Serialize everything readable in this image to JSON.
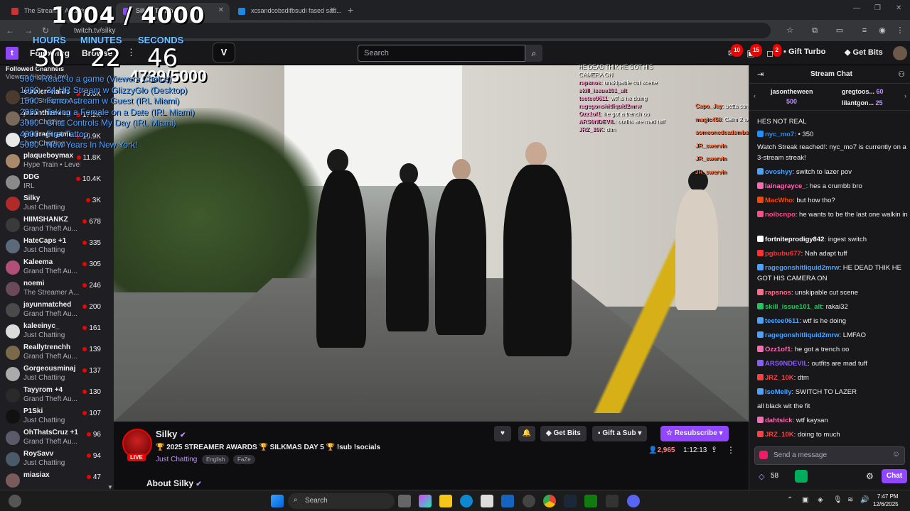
{
  "browser": {
    "tabs": [
      {
        "label": "The Streamer Awards",
        "active": false
      },
      {
        "label": "Silky - Twitch",
        "active": true
      },
      {
        "label": "xcsandcobsdifbsudi fased sad...",
        "active": false
      }
    ],
    "url": "twitch.tv/silky"
  },
  "topnav": {
    "following": "Following",
    "browse": "Browse",
    "search_placeholder": "Search",
    "notif_counts": [
      "10",
      "15",
      "2"
    ],
    "gift_turbo": "Gift Turbo",
    "get_bits": "Get Bits"
  },
  "overlay": {
    "goal": "1004 / 4000",
    "hours_label": "HOURS",
    "minutes_label": "MINUTES",
    "seconds_label": "SECONDS",
    "hours": "30",
    "minutes": "22",
    "seconds": "46",
    "sub_goal": "4739/5000",
    "list": [
      "500 - React to a game (Viewers Choice)",
      "1000 - 24 HR Stream w GlizzyGlo (Desktop)",
      "1500 - Ferrox stream w Guest (IRL Miami)",
      "2000 - Taking a Female on a Date (IRL Miami)",
      "3000 - Chat Controls My Day (IRL Miami)",
      "4000 - First Tattoo",
      "5000 - New Years In New York!"
    ],
    "chat_mid": [
      {
        "user": "",
        "text": "HE DEAD THIK HE GOT HIS"
      },
      {
        "user": "",
        "text": "CAMERA ON"
      },
      {
        "user": "rapsnos",
        "text": "unskipable cut scene"
      },
      {
        "user": "skill_issue101_alt",
        "text": ""
      },
      {
        "user": "teetee0611",
        "text": "wtf is he doing"
      },
      {
        "user": "ragegonshitliquid2mrw",
        "text": ""
      },
      {
        "user": "Ozz1of1",
        "text": "he got a trench oo"
      },
      {
        "user": "ARS0NDEVIL",
        "text": "outfits are mad tuff"
      },
      {
        "user": "JRZ_10K",
        "text": "dtm"
      }
    ],
    "chat_right": [
      {
        "user": "Capo_Jay",
        "text": "betta come bac wit guns out"
      },
      {
        "user": "magic458",
        "text": "Calm 2 weeks"
      },
      {
        "user": "someonedeadsmbshothim4x",
        "text": "@iiiamkemaa youn got ya phone?"
      },
      {
        "user": "JR_swervin",
        "text": ""
      },
      {
        "user": "JR_swervin",
        "text": ""
      },
      {
        "user": "JR_swervin",
        "text": ""
      }
    ]
  },
  "sidebar": {
    "header": "Followed Channels",
    "sort": "Viewers (High to Low)",
    "channels": [
      {
        "name": "stableronaldo",
        "game": "The Streamer A...",
        "viewers": "79.6K",
        "color": "#4a3b2e"
      },
      {
        "name": "jasontheween",
        "game": "Just Chatting",
        "viewers": "17.2K",
        "color": "#7a6a5a"
      },
      {
        "name": "yourragegami...",
        "game": "Just Chatting",
        "viewers": "16.9K",
        "color": "#e8e8e8"
      },
      {
        "name": "plaqueboymax",
        "game": "Hype Train • Level 3",
        "viewers": "11.8K",
        "color": "#a88a6a"
      },
      {
        "name": "DDG",
        "game": "IRL",
        "viewers": "10.4K",
        "color": "#8a8a8a"
      },
      {
        "name": "Silky",
        "game": "Just Chatting",
        "viewers": "3K",
        "color": "#b02a2a"
      },
      {
        "name": "HIIMSHANKZ",
        "game": "Grand Theft Au...",
        "viewers": "678",
        "color": "#3a3a3a"
      },
      {
        "name": "HateCaps +1",
        "game": "Just Chatting",
        "viewers": "335",
        "color": "#5a6a7a"
      },
      {
        "name": "Kaleema",
        "game": "Grand Theft Au...",
        "viewers": "305",
        "color": "#b0507a"
      },
      {
        "name": "noemi",
        "game": "The Streamer A...",
        "viewers": "246",
        "color": "#6a4a5a"
      },
      {
        "name": "jayunmatched",
        "game": "Grand Theft Au...",
        "viewers": "200",
        "color": "#4a4a4a"
      },
      {
        "name": "kaleeinyc_",
        "game": "Just Chatting",
        "viewers": "161",
        "color": "#dcdcdc"
      },
      {
        "name": "Reallytrenchh",
        "game": "Grand Theft Au...",
        "viewers": "139",
        "color": "#7a6a4a"
      },
      {
        "name": "Gorgeousminaj",
        "game": "Just Chatting",
        "viewers": "137",
        "color": "#aaaaaa"
      },
      {
        "name": "Tayyrom +4",
        "game": "Grand Theft Au...",
        "viewers": "130",
        "color": "#2a2a2a"
      },
      {
        "name": "P1Ski",
        "game": "Just Chatting",
        "viewers": "107",
        "color": "#111111"
      },
      {
        "name": "OhThatsCruz +1",
        "game": "Grand Theft Au...",
        "viewers": "96",
        "color": "#5a5a6a"
      },
      {
        "name": "RoySavv",
        "game": "Just Chatting",
        "viewers": "94",
        "color": "#4a5a6a"
      },
      {
        "name": "miasiax",
        "game": "",
        "viewers": "47",
        "color": "#7a5a5a"
      }
    ]
  },
  "stream": {
    "channel": "Silky",
    "live": "LIVE",
    "title": "🏆 2025 STREAMER AWARDS 🏆 SILKMAS DAY 5 🏆 !sub !socials",
    "category": "Just Chatting",
    "tags": [
      "English",
      "FaZe"
    ],
    "viewers": "2,965",
    "uptime": "1:12:13",
    "buttons": {
      "get_bits": "Get Bits",
      "gift_sub": "Gift a Sub",
      "resubscribe": "Resubscribe"
    },
    "about": "About Silky"
  },
  "chat": {
    "title": "Stream Chat",
    "gifters": [
      {
        "name": "jasontheween",
        "count": "500"
      },
      {
        "name": "gregtoos...",
        "count": "60"
      },
      {
        "name": "lilantgon...",
        "count": "25"
      }
    ],
    "messages": [
      {
        "user": "",
        "text": "HES NOT REAL",
        "color": "#ffffff"
      },
      {
        "user": "nyc_mo7",
        "text": "• 350",
        "color": "#1e90ff"
      },
      {
        "user": "",
        "text": "Watch Streak reached!: nyc_mo7 is currently on a 3-stream streak!",
        "color": "#ffffff"
      },
      {
        "user": "ovoshyy",
        "text": "switch to lazer pov",
        "color": "#4aa3ff"
      },
      {
        "user": "lainagrayce_",
        "text": "hes a crumbb bro",
        "color": "#ff69b4"
      },
      {
        "user": "MacWho",
        "text": "but how tho?",
        "color": "#ff4500"
      },
      {
        "user": "noibcnpo",
        "text": "he wants to be the last one walkin in",
        "color": "#ff4d88"
      },
      {
        "user": "fortniteprodigy842",
        "text": "ingest switch",
        "color": "#ffffff"
      },
      {
        "user": "pgbubu677",
        "text": "Nah adapt tuff",
        "color": "#ff3030"
      },
      {
        "user": "ragegonshitliquid2mrw",
        "text": "HE DEAD THIK HE GOT HIS CAMERA ON",
        "color": "#4aa3ff"
      },
      {
        "user": "rapsnos",
        "text": "unskipable cut scene",
        "color": "#ff6b8a"
      },
      {
        "user": "skill_issue101_alt",
        "text": "rakai32",
        "color": "#22c55e"
      },
      {
        "user": "teetee0611",
        "text": "wtf is he doing",
        "color": "#4aa3ff"
      },
      {
        "user": "ragegonshitliquid2mrw",
        "text": "LMFAO",
        "color": "#4aa3ff"
      },
      {
        "user": "Ozz1of1",
        "text": "he got a trench oo",
        "color": "#ff69b4"
      },
      {
        "user": "ARS0NDEVIL",
        "text": "outfits are mad tuff",
        "color": "#8a5cff"
      },
      {
        "user": "JRZ_10K",
        "text": "dtm",
        "color": "#ff4040"
      },
      {
        "user": "IsoMelly",
        "text": "SWITCH TO LAZER",
        "color": "#4aa3ff"
      },
      {
        "user": "",
        "text": "all black wit the fit",
        "color": "#4a4aff"
      },
      {
        "user": "dahtsick",
        "text": "wtf kaysan",
        "color": "#ff69b4"
      },
      {
        "user": "JRZ_10K",
        "text": "doing to much",
        "color": "#ff4040"
      }
    ],
    "input_placeholder": "Send a message",
    "points": "58",
    "send": "Chat"
  },
  "taskbar": {
    "search": "Search",
    "time": "7:47 PM",
    "date": "12/6/2025"
  }
}
